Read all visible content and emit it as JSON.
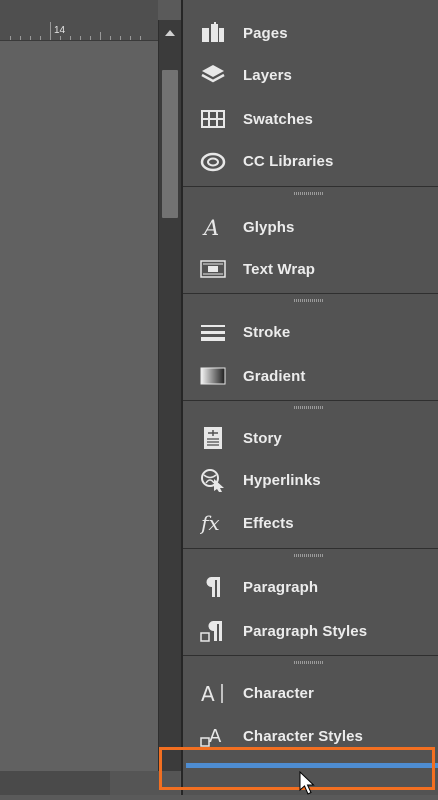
{
  "ruler": {
    "label": "14"
  },
  "panels": [
    {
      "name": "Pages",
      "icon": "pages-icon"
    },
    {
      "name": "Layers",
      "icon": "layers-icon"
    },
    {
      "name": "Swatches",
      "icon": "swatches-icon"
    },
    {
      "name": "CC Libraries",
      "icon": "cc-libraries-icon"
    },
    {
      "name": "Glyphs",
      "icon": "glyphs-icon"
    },
    {
      "name": "Text Wrap",
      "icon": "text-wrap-icon"
    },
    {
      "name": "Stroke",
      "icon": "stroke-icon"
    },
    {
      "name": "Gradient",
      "icon": "gradient-icon"
    },
    {
      "name": "Story",
      "icon": "story-icon"
    },
    {
      "name": "Hyperlinks",
      "icon": "hyperlinks-icon"
    },
    {
      "name": "Effects",
      "icon": "effects-icon"
    },
    {
      "name": "Paragraph",
      "icon": "paragraph-icon"
    },
    {
      "name": "Paragraph Styles",
      "icon": "paragraph-styles-icon"
    },
    {
      "name": "Character",
      "icon": "character-icon"
    },
    {
      "name": "Character Styles",
      "icon": "character-styles-icon"
    }
  ],
  "colors": {
    "highlight": "#f26f21",
    "drop_indicator": "#4e8dd2",
    "panel_bg": "#535353"
  }
}
